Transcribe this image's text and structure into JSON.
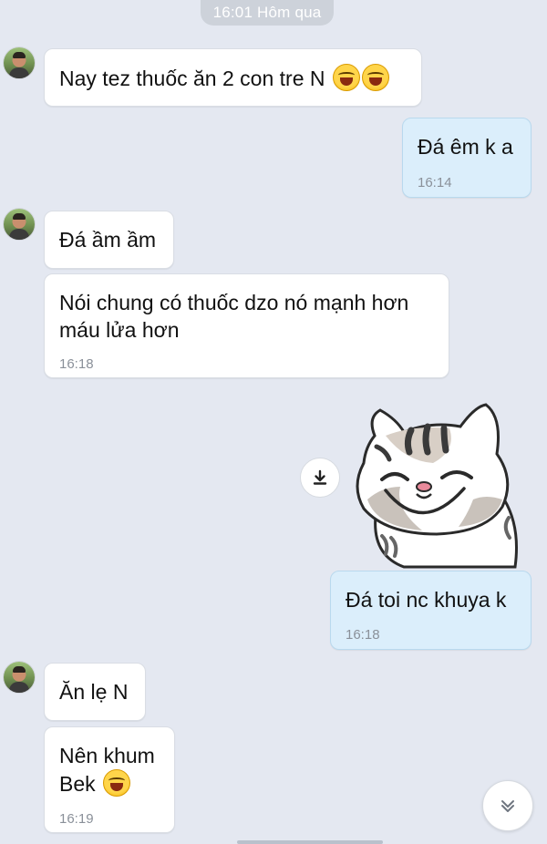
{
  "chat": {
    "date_separator": "16:01 Hôm qua",
    "messages": [
      {
        "side": "in",
        "text": "Nay tez thuốc ăn 2 con tre N",
        "emoji_count": 2
      },
      {
        "side": "out",
        "text": "Đá êm k a",
        "time": "16:14"
      },
      {
        "side": "in",
        "text": "Đá ầm ầm"
      },
      {
        "side": "in",
        "line1": "Nói chung có thuốc dzo nó mạnh hơn",
        "line2": "máu lửa hơn",
        "time": "16:18"
      },
      {
        "side": "out",
        "type": "sticker",
        "description_icon": "smiling-cat-sticker"
      },
      {
        "side": "out",
        "text": "Đá toi nc khuya k",
        "time": "16:18"
      },
      {
        "side": "in",
        "text": "Ăn lẹ N"
      },
      {
        "side": "in",
        "line1": "Nên khum",
        "line2": "Bek",
        "emoji_count": 1,
        "time": "16:19"
      }
    ]
  },
  "icons": {
    "download": "download-icon",
    "scroll_down": "chevron-double-down-icon",
    "emoji": "laughing-emoji-icon"
  },
  "colors": {
    "background": "#e4e8f1",
    "incoming_bubble": "#ffffff",
    "outgoing_bubble": "#dbeefb",
    "timestamp": "#8a9099"
  }
}
